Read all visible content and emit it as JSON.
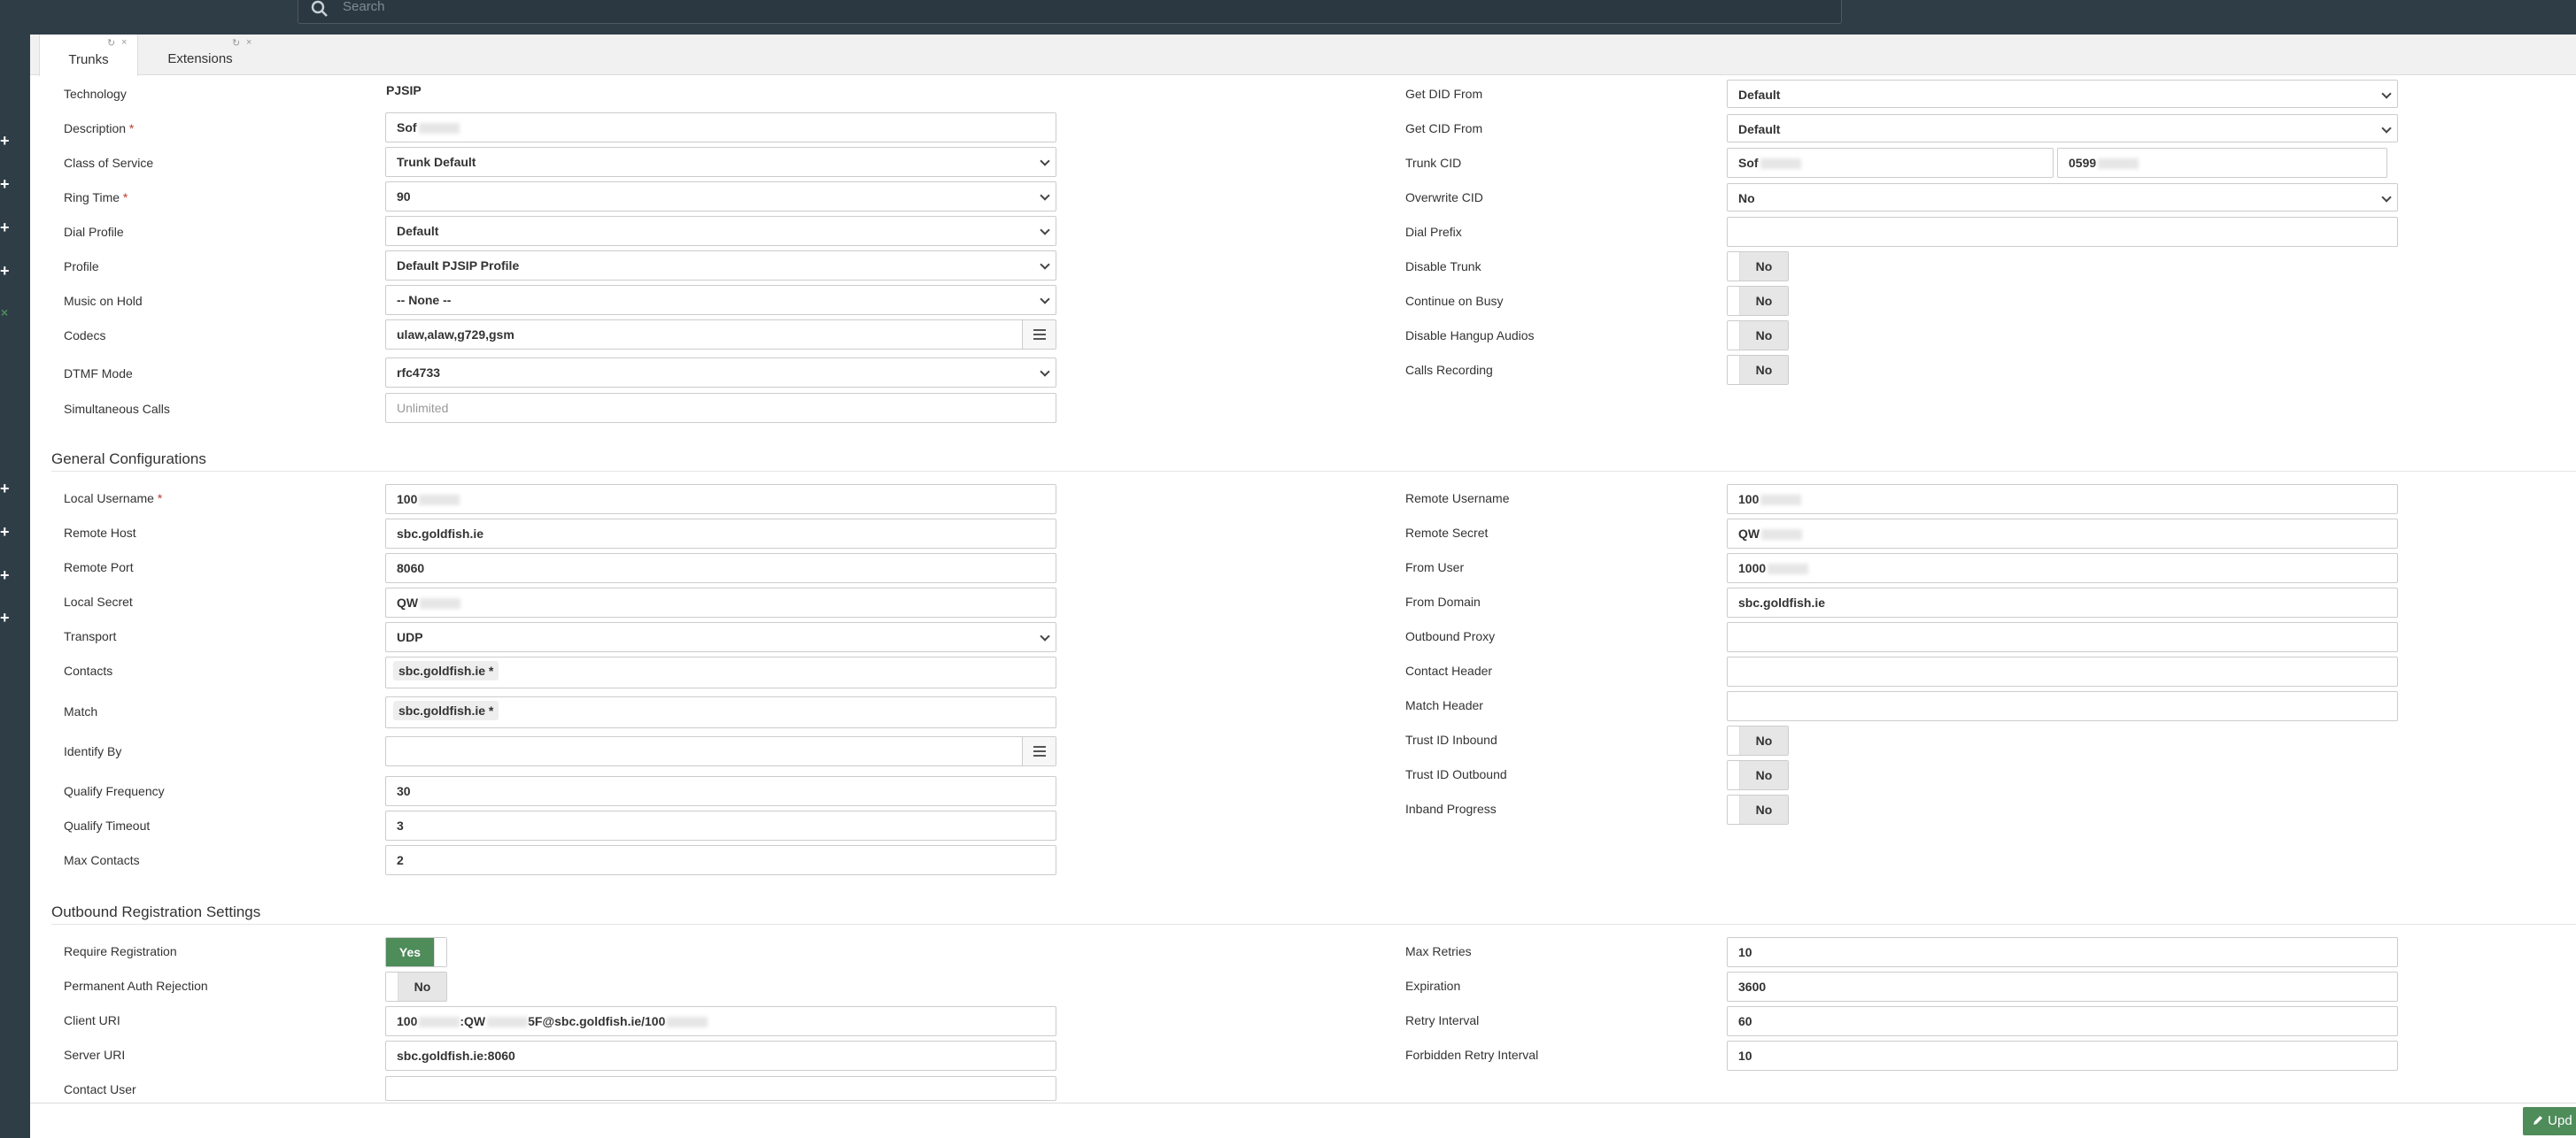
{
  "search": {
    "placeholder": "Search"
  },
  "tabs": [
    {
      "label": "Trunks"
    },
    {
      "label": "Extensions"
    }
  ],
  "tab_icons": {
    "refresh": "↻",
    "close": "×"
  },
  "sidebar": {
    "plus": "+",
    "close": "×"
  },
  "left": {
    "technology": {
      "label": "Technology",
      "value": "PJSIP"
    },
    "description": {
      "label": "Description",
      "value": "Sof"
    },
    "class_of_service": {
      "label": "Class of Service",
      "value": "Trunk Default"
    },
    "ring_time": {
      "label": "Ring Time",
      "value": "90"
    },
    "dial_profile": {
      "label": "Dial Profile",
      "value": "Default"
    },
    "profile": {
      "label": "Profile",
      "value": "Default PJSIP Profile"
    },
    "music_on_hold": {
      "label": "Music on Hold",
      "value": "-- None --"
    },
    "codecs": {
      "label": "Codecs",
      "value": "ulaw,alaw,g729,gsm"
    },
    "dtmf_mode": {
      "label": "DTMF Mode",
      "value": "rfc4733"
    },
    "simultaneous_calls": {
      "label": "Simultaneous Calls",
      "placeholder": "Unlimited"
    }
  },
  "right": {
    "get_did_from": {
      "label": "Get DID From",
      "value": "Default"
    },
    "get_cid_from": {
      "label": "Get CID From",
      "value": "Default"
    },
    "trunk_cid": {
      "label": "Trunk CID",
      "value1": "Sof",
      "value2": "0599"
    },
    "overwrite_cid": {
      "label": "Overwrite CID",
      "value": "No"
    },
    "dial_prefix": {
      "label": "Dial Prefix",
      "value": ""
    },
    "disable_trunk": {
      "label": "Disable Trunk",
      "value": "No"
    },
    "continue_on_busy": {
      "label": "Continue on Busy",
      "value": "No"
    },
    "disable_hangup_audios": {
      "label": "Disable Hangup Audios",
      "value": "No"
    },
    "calls_recording": {
      "label": "Calls Recording",
      "value": "No"
    }
  },
  "general": {
    "heading": "General Configurations",
    "local_username": {
      "label": "Local Username",
      "value": "100"
    },
    "remote_host": {
      "label": "Remote Host",
      "value": "sbc.goldfish.ie"
    },
    "remote_port": {
      "label": "Remote Port",
      "value": "8060"
    },
    "local_secret": {
      "label": "Local Secret",
      "value": "QW"
    },
    "transport": {
      "label": "Transport",
      "value": "UDP"
    },
    "contacts": {
      "label": "Contacts",
      "value": "sbc.goldfish.ie *"
    },
    "match": {
      "label": "Match",
      "value": "sbc.goldfish.ie *"
    },
    "identify_by": {
      "label": "Identify By",
      "value": ""
    },
    "qualify_frequency": {
      "label": "Qualify Frequency",
      "value": "30"
    },
    "qualify_timeout": {
      "label": "Qualify Timeout",
      "value": "3"
    },
    "max_contacts": {
      "label": "Max Contacts",
      "value": "2"
    },
    "remote_username": {
      "label": "Remote Username",
      "value": "100"
    },
    "remote_secret": {
      "label": "Remote Secret",
      "value": "QW"
    },
    "from_user": {
      "label": "From User",
      "value": "1000"
    },
    "from_domain": {
      "label": "From Domain",
      "value": "sbc.goldfish.ie"
    },
    "outbound_proxy": {
      "label": "Outbound Proxy",
      "value": ""
    },
    "contact_header": {
      "label": "Contact Header",
      "value": ""
    },
    "match_header": {
      "label": "Match Header",
      "value": ""
    },
    "trust_id_inbound": {
      "label": "Trust ID Inbound",
      "value": "No"
    },
    "trust_id_outbound": {
      "label": "Trust ID Outbound",
      "value": "No"
    },
    "inband_progress": {
      "label": "Inband Progress",
      "value": "No"
    }
  },
  "outbound": {
    "heading": "Outbound Registration Settings",
    "require_registration": {
      "label": "Require Registration",
      "value": "Yes"
    },
    "permanent_auth_rejection": {
      "label": "Permanent Auth Rejection",
      "value": "No"
    },
    "client_uri": {
      "label": "Client URI",
      "value_a": "100",
      "value_b": ":QW",
      "value_c": "5F@sbc.goldfish.ie/100"
    },
    "server_uri": {
      "label": "Server URI",
      "value": "sbc.goldfish.ie:8060"
    },
    "contact_user": {
      "label": "Contact User",
      "value": ""
    },
    "max_retries": {
      "label": "Max Retries",
      "value": "10"
    },
    "expiration": {
      "label": "Expiration",
      "value": "3600"
    },
    "retry_interval": {
      "label": "Retry Interval",
      "value": "60"
    },
    "forbidden_retry_interval": {
      "label": "Forbidden Retry Interval",
      "value": "10"
    }
  },
  "required_mark": "*",
  "update_button": {
    "label": "Upd"
  },
  "colors": {
    "topbar": "#2f3d47",
    "toggle_yes": "#4e8c5a",
    "toggle_no": "#e6e6e6"
  }
}
